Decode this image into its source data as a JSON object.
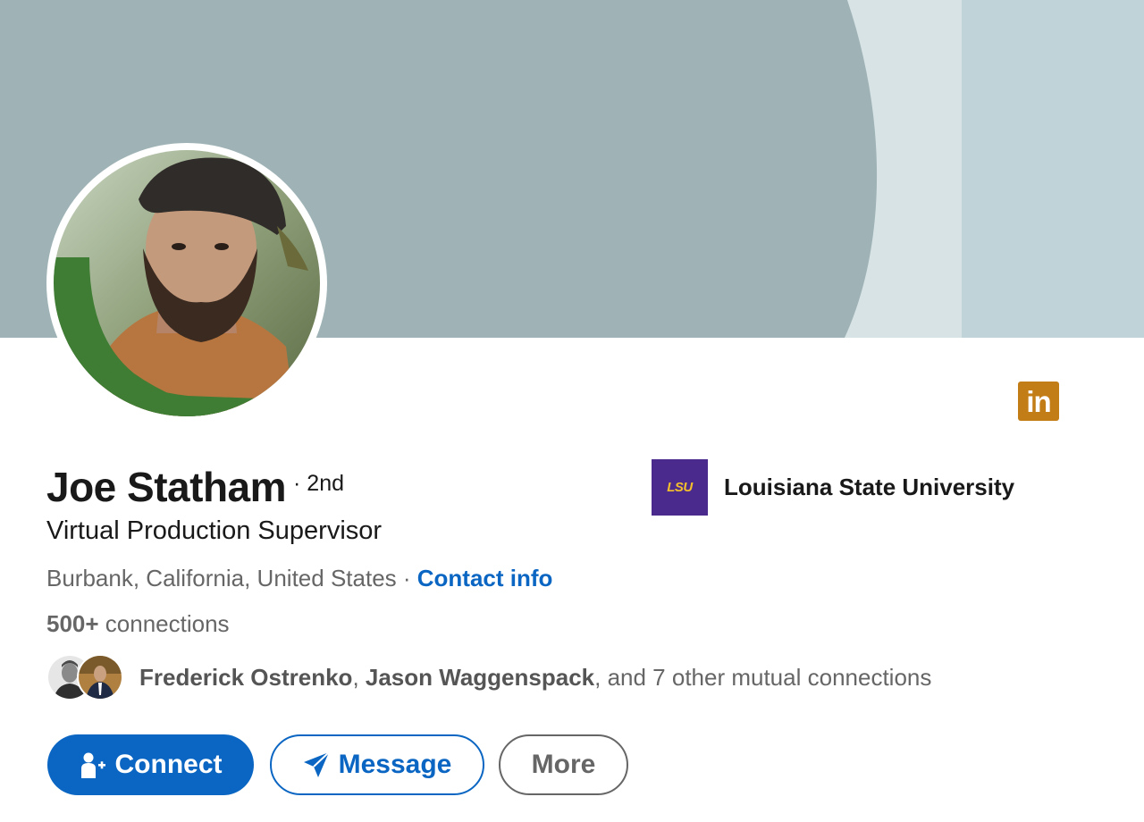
{
  "profile": {
    "name": "Joe Statham",
    "degree": "· 2nd",
    "headline": "Virtual Production Supervisor",
    "location": "Burbank, California, United States",
    "location_separator": " · ",
    "contact_info_label": "Contact info",
    "connections_count": "500+",
    "connections_label": " connections"
  },
  "mutual": {
    "name_1": "Frederick Ostrenko",
    "separator": ", ",
    "name_2": "Jason Waggenspack",
    "rest": ", and 7 other mutual connections"
  },
  "education": {
    "logo_text": "LSU",
    "name": "Louisiana State University"
  },
  "badge": {
    "text": "in"
  },
  "actions": {
    "connect_label": "Connect",
    "message_label": "Message",
    "more_label": "More"
  },
  "colors": {
    "primary_blue": "#0a66c2",
    "cover_main": "#9fb3b6",
    "cover_accent": "#bfd3d8",
    "badge_gold": "#c37d16",
    "lsu_purple": "#4b2a8e",
    "lsu_gold": "#f3c02b",
    "open_to_work_green": "#3f7c34"
  },
  "icons": {
    "connect": "person-add-icon",
    "message": "send-icon",
    "brand": "linkedin-logo-icon"
  }
}
